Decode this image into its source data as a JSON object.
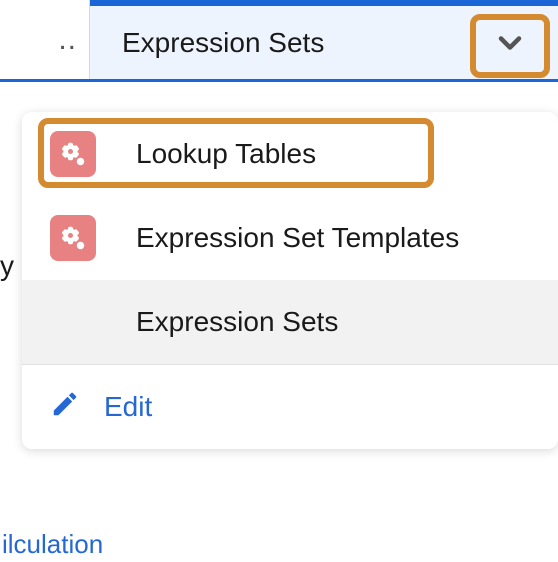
{
  "tab": {
    "truncated_left": "..",
    "active_label": "Expression Sets"
  },
  "menu": {
    "items": [
      {
        "label": "Lookup Tables",
        "has_icon": true,
        "highlighted": true,
        "selected": false
      },
      {
        "label": "Expression Set Templates",
        "has_icon": true,
        "highlighted": false,
        "selected": false
      },
      {
        "label": "Expression Sets",
        "has_icon": false,
        "highlighted": false,
        "selected": true
      }
    ],
    "edit_label": "Edit"
  },
  "bg_cut_text": "y",
  "bottom_cut_text": "ilculation",
  "colors": {
    "highlight_border": "#d48a2e",
    "accent_blue": "#1b66d6",
    "icon_bg": "#e88282",
    "link_blue": "#2568d4"
  }
}
